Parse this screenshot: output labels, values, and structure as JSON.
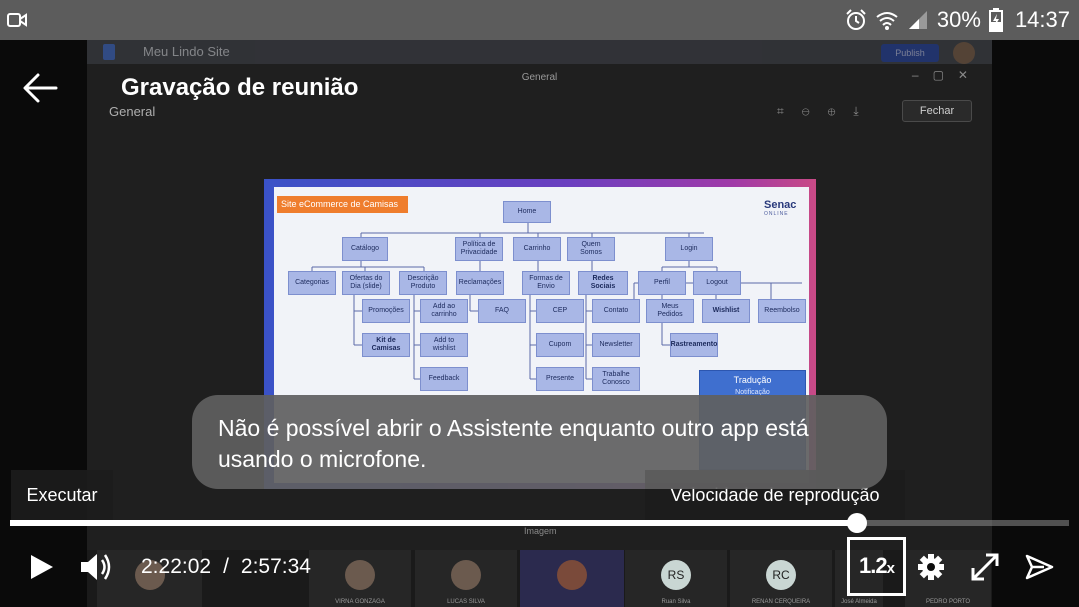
{
  "status_bar": {
    "icons": [
      "video-camera-icon",
      "alarm-clock-icon",
      "wifi-icon",
      "cellular-signal-icon",
      "battery-icon"
    ],
    "battery_percent": "30%",
    "time": "14:37"
  },
  "background": {
    "doc_title": "Meu Lindo Site",
    "publish_label": "Publish",
    "viewer_title": "General",
    "viewer_channel": "General",
    "fechar_label": "Fechar",
    "image_label": "Imagem"
  },
  "slide": {
    "tag": "Site eCommerce de Camisas",
    "logo": "Senac",
    "logo_sub": "ONLINE",
    "nodes": {
      "home": "Home",
      "catalogo": "Catálogo",
      "politica": "Política de Privacidade",
      "carrinho": "Carrinho",
      "quem_somos": "Quem Somos",
      "login": "Login",
      "categorias": "Categorias",
      "ofertas": "Ofertas do Dia (slide)",
      "descricao": "Descrição Produto",
      "reclamacoes": "Reclamações",
      "formas_envio": "Formas de Envio",
      "redes_sociais": "Redes Sociais",
      "perfil": "Perfil",
      "logout": "Logout",
      "promocoes": "Promoções",
      "add_carrinho": "Add ao carrinho",
      "faq": "FAQ",
      "cep": "CEP",
      "contato": "Contato",
      "meus_pedidos": "Meus Pedidos",
      "wishlist": "Wishlist",
      "reembolso": "Reembolso",
      "kit_camisas": "Kit de Camisas",
      "add_wishlist": "Add to wishlist",
      "cupom": "Cupom",
      "newsletter": "Newsletter",
      "rastreamento": "Rastreamento",
      "feedback": "Feedback",
      "presente": "Presente",
      "trabalhe": "Trabalhe Conosco"
    },
    "traducao": "Tradução",
    "notificacao": "Notificação"
  },
  "overlay": {
    "title": "Gravação de reunião",
    "toast": "Não é possível abrir o Assistente enquanto outro app está usando o microfone.",
    "tooltip_play": "Executar",
    "tooltip_speed": "Velocidade de reprodução"
  },
  "playback": {
    "current_time": "2:22:02",
    "separator": "/",
    "total_time": "2:57:34",
    "progress_fraction": 0.8,
    "speed": "1.2",
    "speed_suffix": "x"
  },
  "participants": [
    {
      "name": "",
      "initials": ""
    },
    {
      "name": "VIRNA GONZAGA",
      "initials": ""
    },
    {
      "name": "LUCAS SILVA",
      "initials": ""
    },
    {
      "name": "",
      "initials": ""
    },
    {
      "name": "Ruan Silva",
      "initials": "RS"
    },
    {
      "name": "RENAN CERQUEIRA",
      "initials": "RC"
    },
    {
      "name": "José Almeida",
      "initials": ""
    },
    {
      "name": "PEDRO PORTO",
      "initials": ""
    }
  ]
}
